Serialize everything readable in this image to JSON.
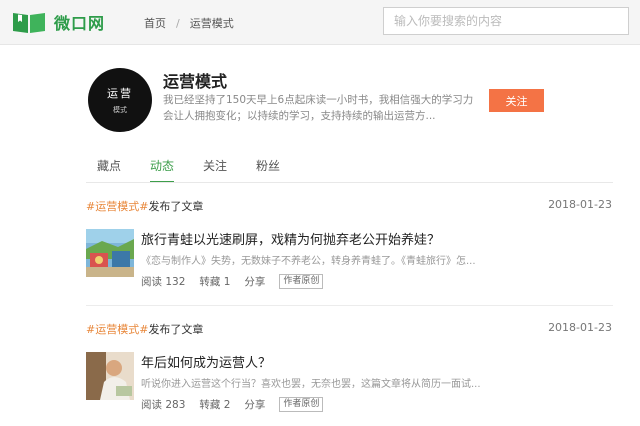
{
  "header": {
    "logo_text": "微口网",
    "breadcrumb": {
      "home": "首页",
      "separator": "/",
      "current": "运营模式"
    },
    "search_placeholder": "输入你要搜索的内容"
  },
  "profile": {
    "avatar_text_top": "运营",
    "avatar_text_bottom": "模式",
    "name": "运营模式",
    "description": "我已经坚持了150天早上6点起床读一小时书，我相信强大的学习力会让人拥抱变化；以持续的学习，支持持续的输出运营方...",
    "follow_label": "关注"
  },
  "tabs": [
    {
      "label": "藏点",
      "active": false
    },
    {
      "label": "动态",
      "active": true
    },
    {
      "label": "关注",
      "active": false
    },
    {
      "label": "粉丝",
      "active": false
    }
  ],
  "posts": [
    {
      "tag": "#运营模式#",
      "action": "发布了文章",
      "date": "2018-01-23",
      "title": "旅行青蛙以光速刷屏，戏精为何抛弃老公开始养娃？",
      "excerpt": "《恋与制作人》失势，无数妹子不养老公，转身养青蛙了。《青蛙旅行》怎...",
      "reads": "阅读 132",
      "shares": "转藏 1",
      "share_label": "分享",
      "badge": "作者原创"
    },
    {
      "tag": "#运营模式#",
      "action": "发布了文章",
      "date": "2018-01-23",
      "title": "年后如何成为运营人？",
      "excerpt": "听说你进入运营这个行当？喜欢也罢，无奈也罢，这篇文章将从简历一面试...",
      "reads": "阅读 283",
      "shares": "转藏 2",
      "share_label": "分享",
      "badge": "作者原创"
    }
  ],
  "colors": {
    "brand_green": "#2e9c4a",
    "follow_orange": "#f47345",
    "tag_orange": "#e8873a"
  }
}
